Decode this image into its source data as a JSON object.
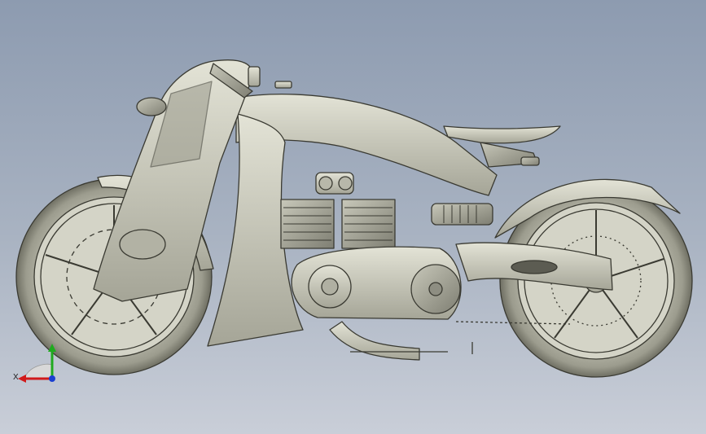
{
  "viewport": {
    "background_top": "#8d9bb0",
    "background_bottom": "#c9ced8"
  },
  "model": {
    "icon": "motorcycle-cad-model",
    "body_color": "#c9c9bb",
    "outline_color": "#3a3a32"
  },
  "triad": {
    "x_label": "X",
    "y_label": "",
    "x_color": "#d11a1a",
    "y_color": "#1faa1f",
    "z_color": "#1a3fd1"
  }
}
